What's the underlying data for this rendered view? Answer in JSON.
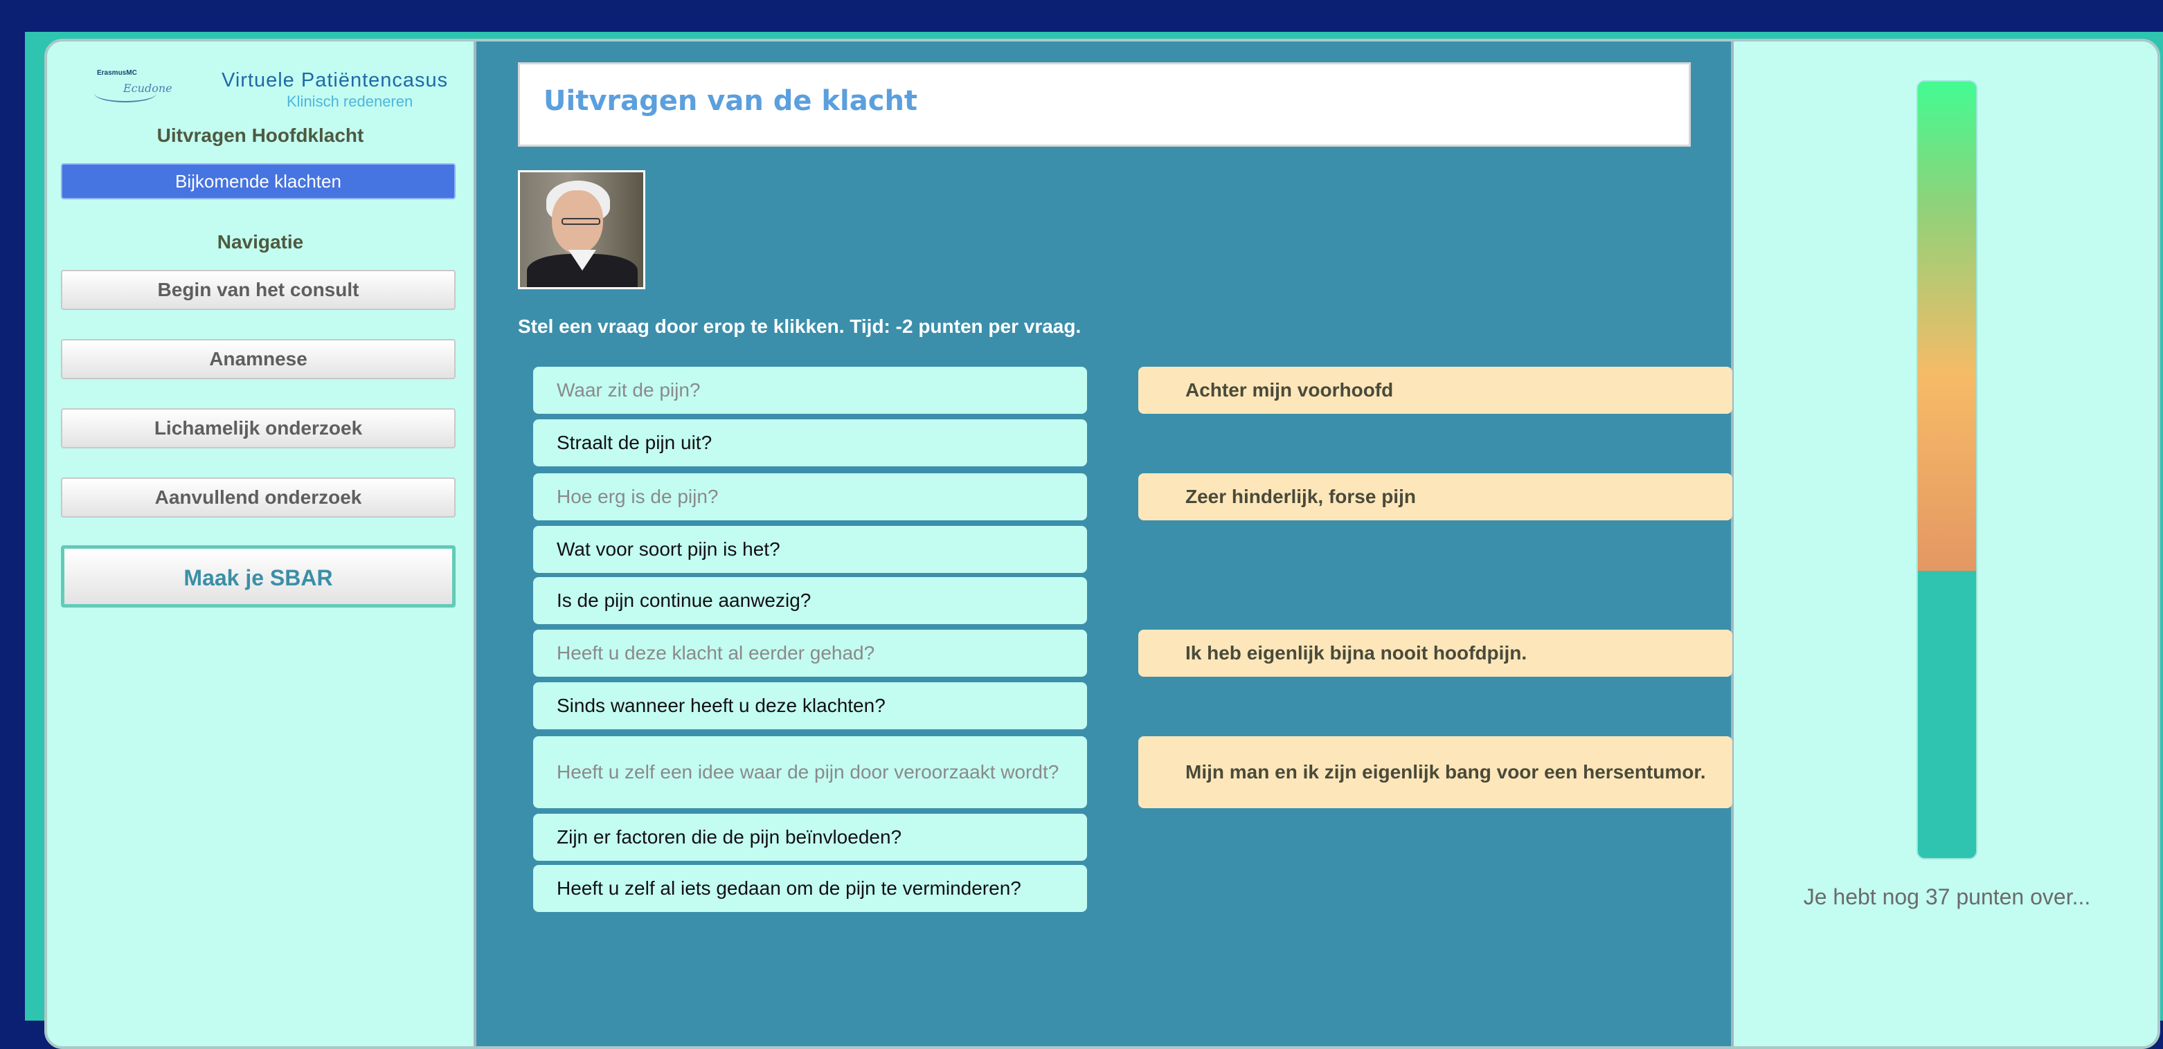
{
  "app": {
    "logo_small": "ErasmusMC",
    "logo_script": "Ecudone",
    "logo_title": "Virtuele Patiëntencasus",
    "logo_subtitle": "Klinisch redeneren"
  },
  "sidebar": {
    "section_heading": "Uitvragen Hoofdklacht",
    "active_item": "Bijkomende klachten",
    "nav_heading": "Navigatie",
    "nav_items": [
      "Begin van het consult",
      "Anamnese",
      "Lichamelijk onderzoek",
      "Aanvullend onderzoek"
    ],
    "sbar_button": "Maak je SBAR"
  },
  "main": {
    "title": "Uitvragen van de klacht",
    "instruction": "Stel een vraag door erop te klikken. Tijd: -2 punten per vraag.",
    "questions": [
      {
        "text": "Waar zit de pijn?",
        "asked": true,
        "answer": "Achter mijn voorhoofd"
      },
      {
        "text": "Straalt de pijn uit?",
        "asked": false,
        "answer": ""
      },
      {
        "text": "Hoe erg is de pijn?",
        "asked": true,
        "answer": "Zeer hinderlijk, forse pijn"
      },
      {
        "text": "Wat voor soort pijn is het?",
        "asked": false,
        "answer": ""
      },
      {
        "text": "Is de pijn continue aanwezig?",
        "asked": false,
        "answer": ""
      },
      {
        "text": "Heeft u deze klacht al eerder gehad?",
        "asked": true,
        "answer": "Ik heb eigenlijk bijna nooit hoofdpijn."
      },
      {
        "text": "Sinds wanneer heeft u deze klachten?",
        "asked": false,
        "answer": ""
      },
      {
        "text": "Heeft u zelf een idee waar de pijn door veroorzaakt wordt?",
        "asked": true,
        "answer": "Mijn man en ik zijn eigenlijk bang voor een hersentumor."
      },
      {
        "text": "Zijn er factoren die de pijn beïnvloeden?",
        "asked": false,
        "answer": ""
      },
      {
        "text": "Heeft u zelf al iets gedaan om de pijn te verminderen?",
        "asked": false,
        "answer": ""
      }
    ]
  },
  "score": {
    "points_text": "Je hebt nog 37 punten over...",
    "points_remaining": 37,
    "meter_level": 0.63,
    "colors": {
      "meter_top": "#43fb92",
      "meter_mid": "#f6bb67",
      "meter_bottom": "#2ec4b0"
    }
  }
}
